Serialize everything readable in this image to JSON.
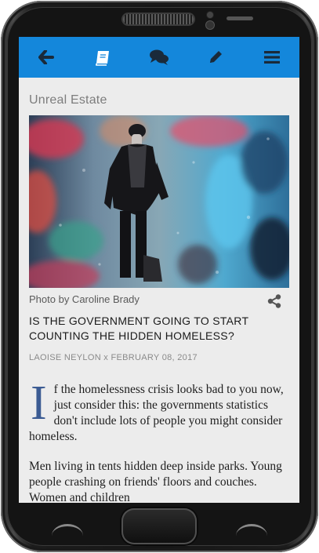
{
  "topbar": {
    "color": "#1487db",
    "icons": [
      "back-arrow-icon",
      "book-icon",
      "comments-icon",
      "pencil-icon",
      "menu-icon"
    ]
  },
  "section": {
    "title": "Unreal Estate"
  },
  "photo": {
    "credit": "Photo by Caroline Brady"
  },
  "article": {
    "headline": "IS THE GOVERNMENT GOING TO START COUNTING THE HIDDEN HOMELESS?",
    "byline": "LAOISE NEYLON x FEBRUARY 08, 2017",
    "dropcap": "I",
    "para1": "f the homelessness crisis looks bad to you now, just consider this: the governments statistics don't include lots of people you might consider homeless.",
    "para2": "Men living in tents hidden deep inside parks. Young people crashing on friends' floors and couches. Women and children"
  },
  "colors": {
    "dropcap": "#3b5b93",
    "screen_bg": "#ececec"
  }
}
